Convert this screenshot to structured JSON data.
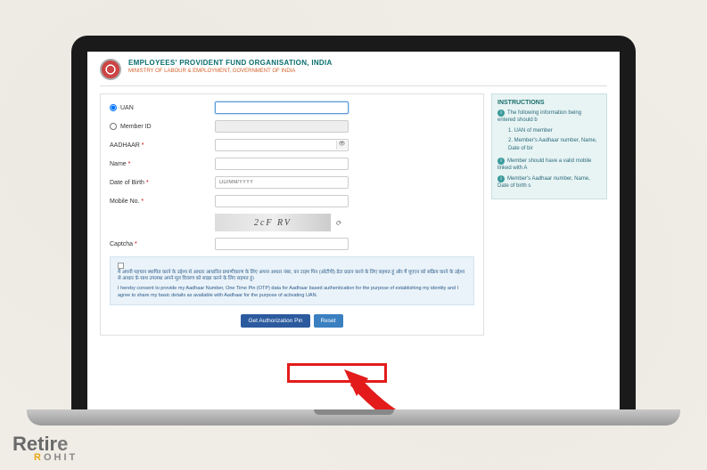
{
  "header": {
    "title": "EMPLOYEES' PROVIDENT FUND ORGANISATION, INDIA",
    "subtitle": "MINISTRY OF LABOUR & EMPLOYMENT, GOVERNMENT OF INDIA"
  },
  "form": {
    "uan_label": "UAN",
    "member_id_label": "Member ID",
    "aadhaar_label": "AADHAAR",
    "name_label": "Name",
    "dob_label": "Date of Birth",
    "dob_placeholder": "DD/MM/YYYY",
    "mobile_label": "Mobile No.",
    "captcha_label": "Captcha",
    "captcha_text": "2cF RV",
    "consent_hindi": "मैं अपनी पहचान स्थापित करने के उद्देश्य से आधार आधारित प्रमाणीकरण के लिए अपना आधार नंबर, वन टाइम पिन (ओटीपी) डेटा प्रदान करने के लिए सहमत हूं और मैं यूएएन को सक्रिय करने के उद्देश्य से आधार के साथ उपलब्ध अपने मूल विवरण को साझा करने के लिए सहमत हूं।",
    "consent_en": "I hereby consent to provide my Aadhaar Number, One Time Pin (OTP) data for Aadhaar based authentication for the purpose of establishing my identity and I agree to share my basic details as available with Aadhaar for the purpose of activating UAN.",
    "btn_primary": "Get Authorization Pin",
    "btn_reset": "Reset"
  },
  "instructions": {
    "title": "INSTRUCTIONS",
    "line1": "The following information being entered should b",
    "item1": "1. UAN of member",
    "item2": "2. Member's Aadhaar number, Name, Date of bir",
    "line2": "Member should have a valid mobile linked with A",
    "line3": "Member's Aadhaar number, Name, Date of birth s"
  },
  "watermark": {
    "line1a": "Retir",
    "line1b": "e",
    "line2a": "R",
    "line2b": "OHIT"
  }
}
